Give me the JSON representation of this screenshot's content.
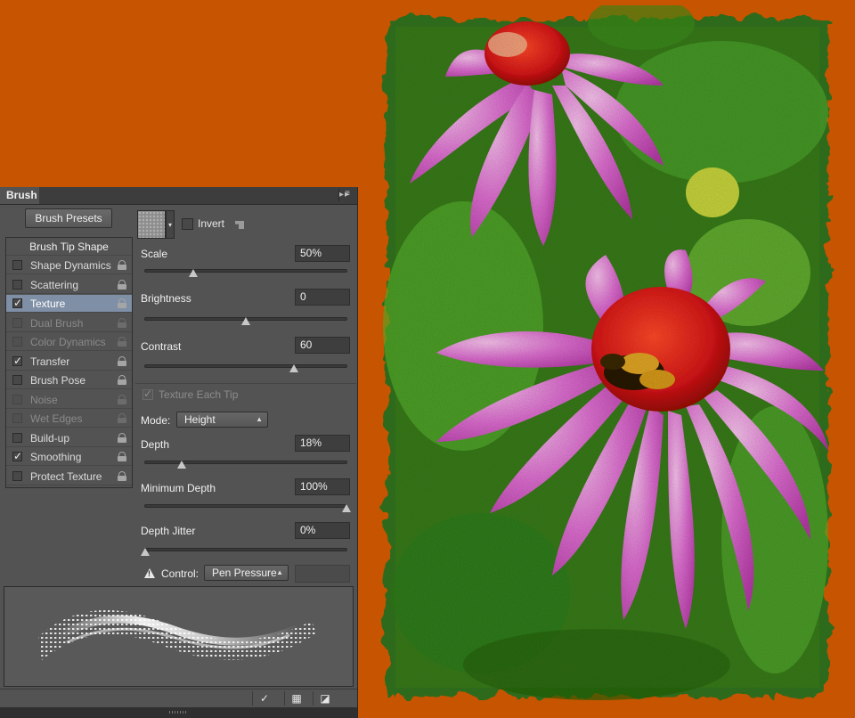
{
  "panel": {
    "tab_label": "Brush",
    "header_actions": "▸▸",
    "menu_icon": "panel-menu-icon",
    "presets_button": "Brush Presets",
    "list_header": "Brush Tip Shape",
    "items": [
      {
        "label": "Shape Dynamics",
        "checked": false,
        "enabled": true,
        "selected": false
      },
      {
        "label": "Scattering",
        "checked": false,
        "enabled": true,
        "selected": false
      },
      {
        "label": "Texture",
        "checked": true,
        "enabled": true,
        "selected": true
      },
      {
        "label": "Dual Brush",
        "checked": false,
        "enabled": false,
        "selected": false
      },
      {
        "label": "Color Dynamics",
        "checked": false,
        "enabled": false,
        "selected": false
      },
      {
        "label": "Transfer",
        "checked": true,
        "enabled": true,
        "selected": false
      },
      {
        "label": "Brush Pose",
        "checked": false,
        "enabled": true,
        "selected": false
      },
      {
        "label": "Noise",
        "checked": false,
        "enabled": false,
        "selected": false
      },
      {
        "label": "Wet Edges",
        "checked": false,
        "enabled": false,
        "selected": false
      },
      {
        "label": "Build-up",
        "checked": false,
        "enabled": true,
        "selected": false
      },
      {
        "label": "Smoothing",
        "checked": true,
        "enabled": true,
        "selected": false
      },
      {
        "label": "Protect Texture",
        "checked": false,
        "enabled": true,
        "selected": false
      }
    ]
  },
  "texture": {
    "invert_label": "Invert",
    "invert_checked": false,
    "scale": {
      "label": "Scale",
      "value": "50%",
      "level": 0.24
    },
    "brightness": {
      "label": "Brightness",
      "value": "0",
      "level": 0.5
    },
    "contrast": {
      "label": "Contrast",
      "value": "60",
      "level": 0.74
    },
    "each_tip_label": "Texture Each Tip",
    "mode_label": "Mode:",
    "mode_value": "Height",
    "depth": {
      "label": "Depth",
      "value": "18%",
      "level": 0.18
    },
    "min_depth": {
      "label": "Minimum Depth",
      "value": "100%",
      "level": 1.0
    },
    "depth_jitter": {
      "label": "Depth Jitter",
      "value": "0%",
      "level": 0.0
    },
    "control_label": "Control:",
    "control_value": "Pen Pressure"
  },
  "footer": {
    "tools": [
      "✓",
      "▦",
      "◪"
    ]
  },
  "colors": {
    "background": "#c65400",
    "panel": "#535353",
    "selected": "#7f8fa6"
  }
}
